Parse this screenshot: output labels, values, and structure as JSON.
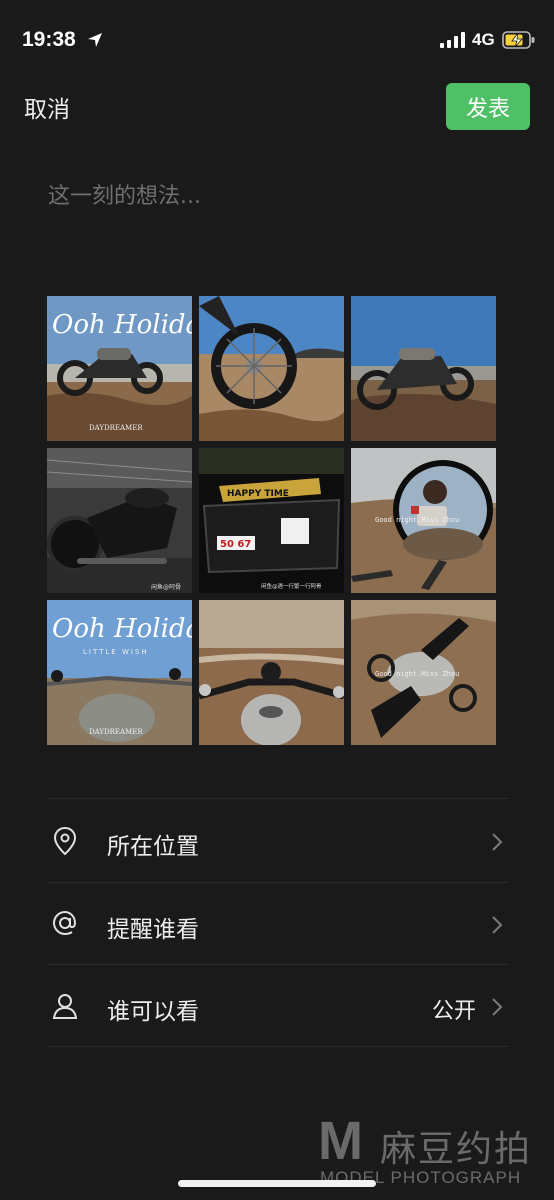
{
  "status": {
    "time": "19:38",
    "network": "4G"
  },
  "header": {
    "cancel_label": "取消",
    "publish_label": "发表",
    "publish_color": "#4fc065"
  },
  "composer": {
    "placeholder": "这一刻的想法..."
  },
  "photos": {
    "count": 9,
    "texts": {
      "holiday": "Ooh Holiday",
      "daydreamer": "DAYDREAMER",
      "little": "LITTLE WISH",
      "goodnight": "Good night.Miss Zhou",
      "credit1": "闲鱼@阿骨",
      "credit2": "闲鱼@遇一行繁一行阿骨",
      "plate": "50 67",
      "banner": "HAPPY TIME"
    }
  },
  "options": [
    {
      "label": "所在位置",
      "icon": "location-pin-icon",
      "value": ""
    },
    {
      "label": "提醒谁看",
      "icon": "at-sign-icon",
      "value": ""
    },
    {
      "label": "谁可以看",
      "icon": "person-icon",
      "value": "公开"
    }
  ],
  "watermark": {
    "letter": "M",
    "brand": "麻豆约拍",
    "subtitle": "MODEL PHOTOGRAPH"
  }
}
